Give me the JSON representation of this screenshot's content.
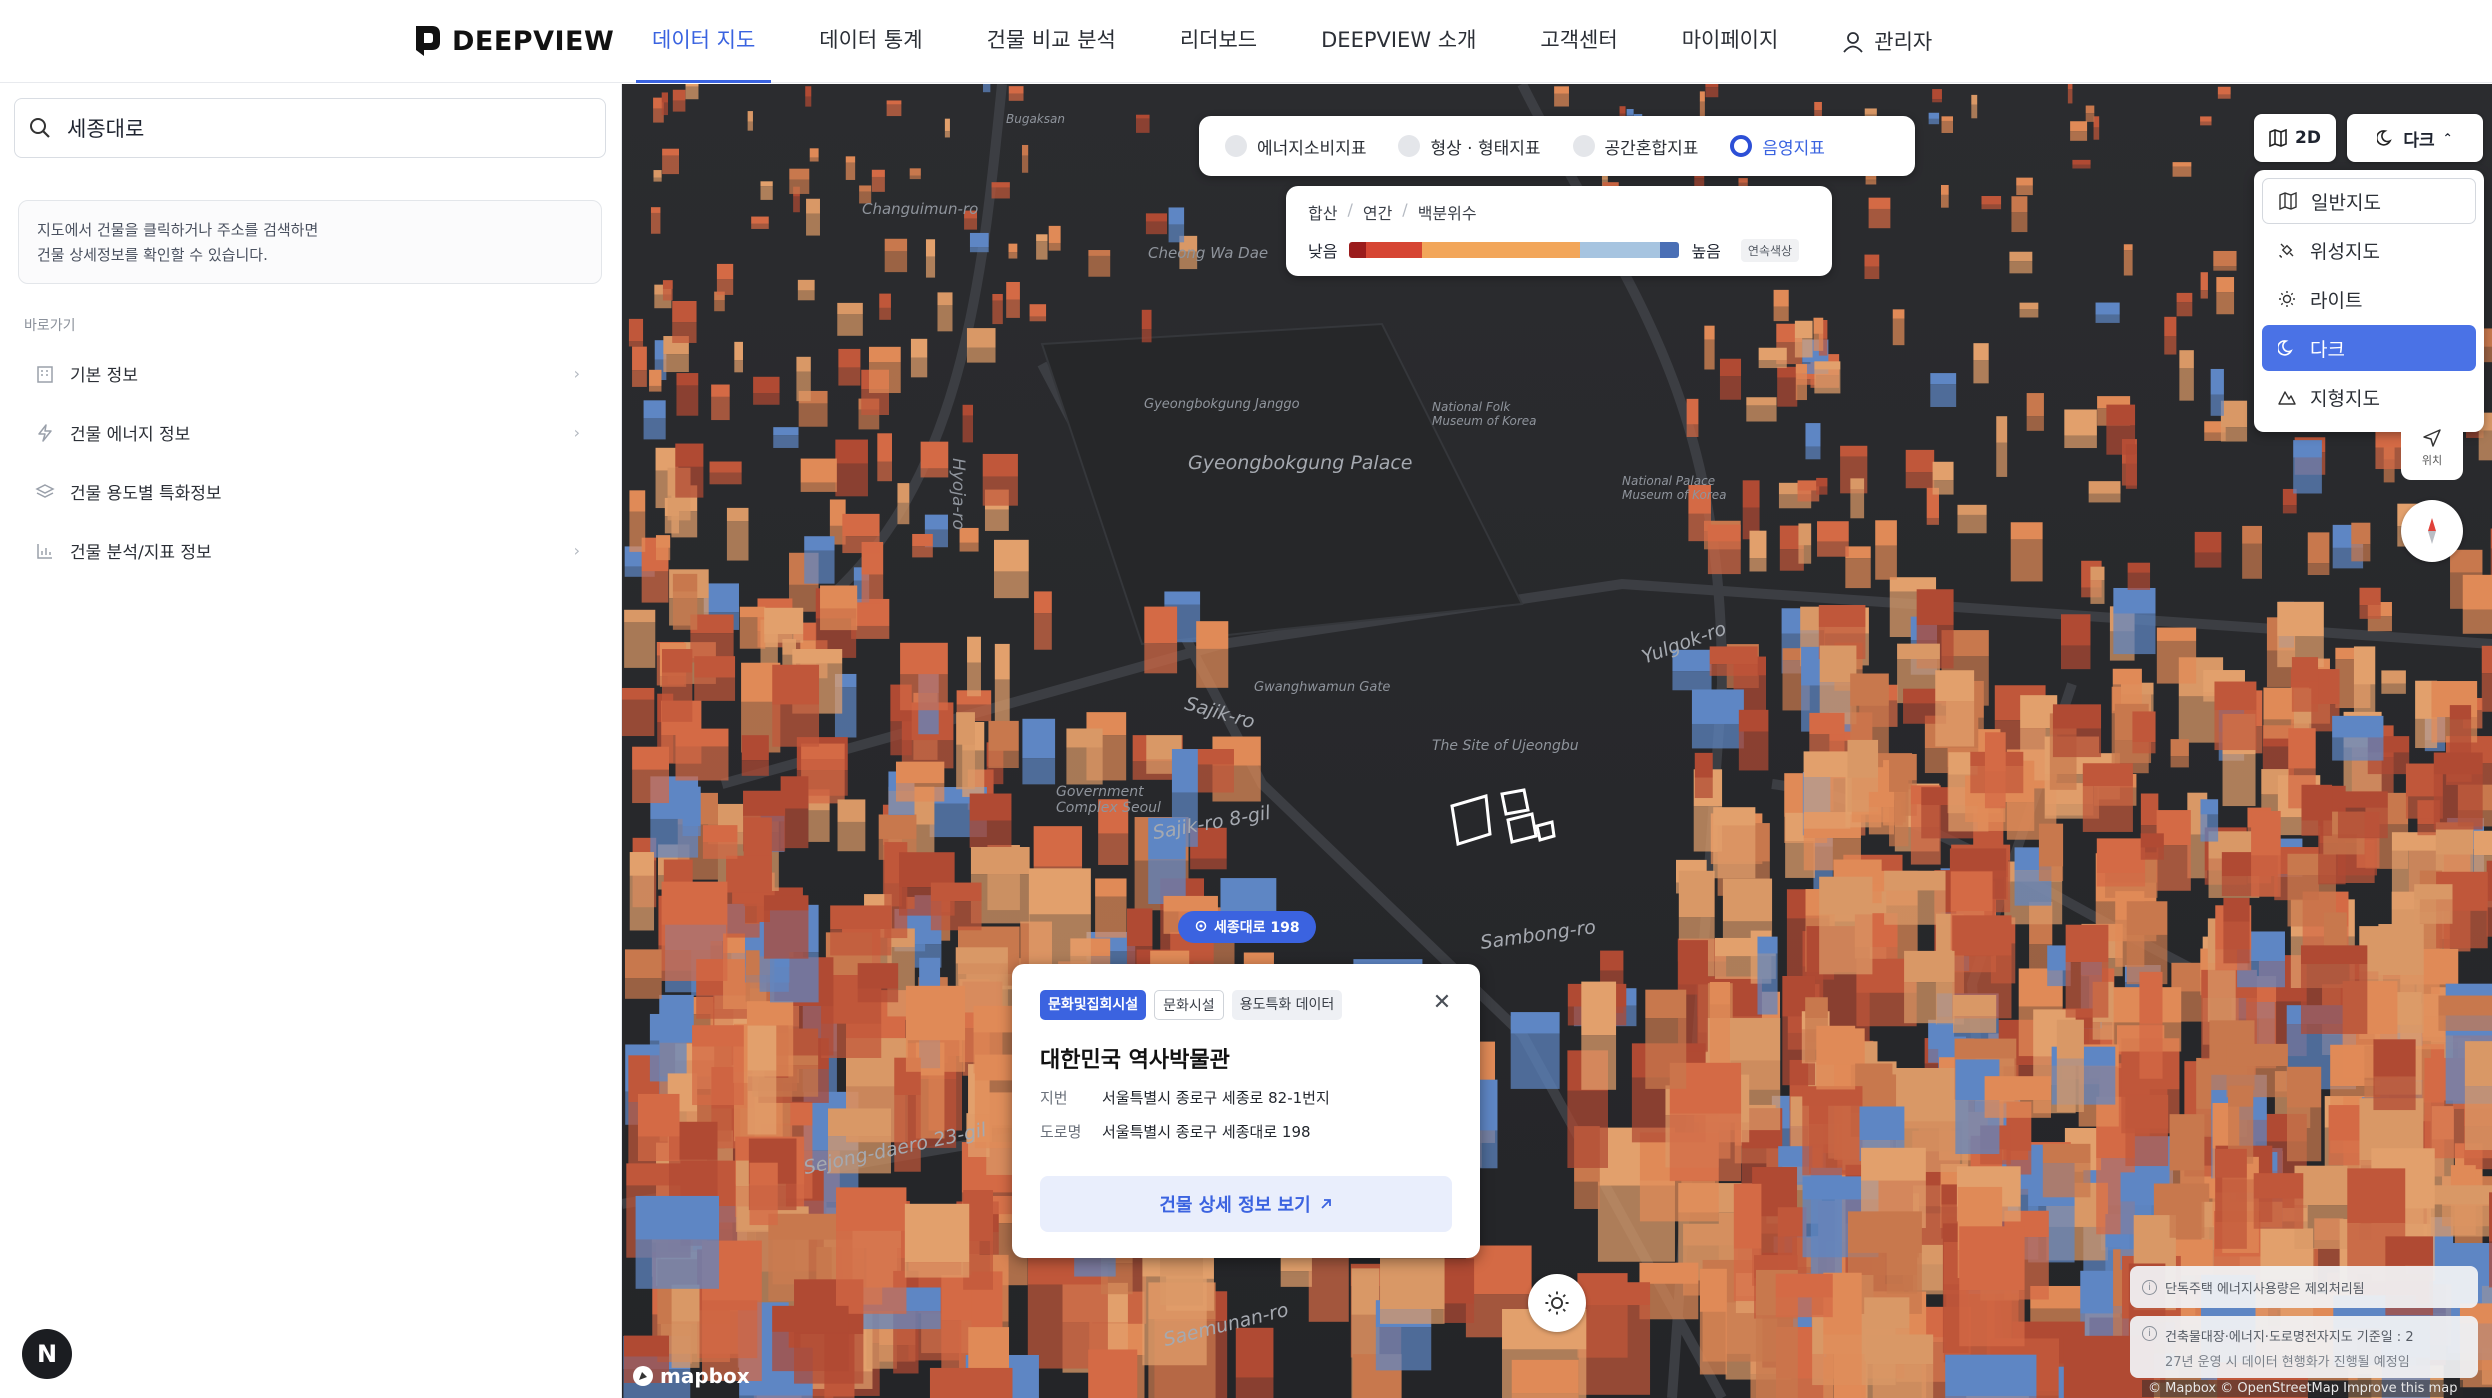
{
  "header": {
    "logo_text": "DEEPVIEW",
    "nav": [
      {
        "label": "데이터 지도",
        "active": true
      },
      {
        "label": "데이터 통계"
      },
      {
        "label": "건물 비교 분석"
      },
      {
        "label": "리더보드"
      },
      {
        "label": "DEEPVIEW 소개"
      },
      {
        "label": "고객센터"
      },
      {
        "label": "마이페이지"
      }
    ],
    "user_label": "관리자"
  },
  "sidebar": {
    "search_value": "세종대로",
    "hint_line1": "지도에서 건물을 클릭하거나 주소를 검색하면",
    "hint_line2": "건물 상세정보를 확인할 수 있습니다.",
    "section_label": "바로가기",
    "items": [
      {
        "label": "기본 정보",
        "icon": "building-icon"
      },
      {
        "label": "건물 에너지 정보",
        "icon": "lightning-icon"
      },
      {
        "label": "건물 용도별 특화정보",
        "icon": "layers-icon"
      },
      {
        "label": "건물 분석/지표 정보",
        "icon": "bar-chart-icon"
      }
    ],
    "badge": "N"
  },
  "map": {
    "index_tabs": [
      {
        "label": "에너지소비지표"
      },
      {
        "label": "형상 · 형태지표"
      },
      {
        "label": "공간혼합지표"
      },
      {
        "label": "음영지표",
        "active": true
      }
    ],
    "legend": {
      "crumbs": [
        "합산",
        "연간",
        "백분위수"
      ],
      "low": "낮음",
      "high": "높음",
      "chip": "연속색상",
      "colors": [
        "#9b1c1c",
        "#d64533",
        "#f2a65a",
        "#a6c4e0",
        "#4a6fb5"
      ]
    },
    "view_toggle": "2D",
    "style_button": "다크",
    "styles": [
      {
        "label": "일반지도",
        "icon": "map-icon"
      },
      {
        "label": "위성지도",
        "icon": "satellite-icon"
      },
      {
        "label": "라이트",
        "icon": "sun-icon"
      },
      {
        "label": "다크",
        "icon": "moon-icon",
        "selected": true
      },
      {
        "label": "지형지도",
        "icon": "mountain-icon"
      }
    ],
    "locate_label": "위치",
    "address_pin": "세종대로 198",
    "labels": {
      "palace": "Gyeongbokgung Palace",
      "palace_gate": "Gyeongbokgung Janggo",
      "cheong": "Cheong Wa Dae",
      "sajik": "Sajik-ro",
      "sajik8": "Sajik-ro 8-gil",
      "sambong": "Sambong-ro",
      "yulgok": "Yulgok-ro",
      "hyoja": "Hyoja-ro",
      "saemunan": "Saemunan-ro",
      "sejong23": "Sejong-daero 23-gil",
      "gwanghwamun": "Gwanghwamun Gate",
      "museum": "National Folk Museum of Korea",
      "govt": "Government Complex Seoul",
      "national_museum": "National Palace Museum of Korea",
      "ujeongbu": "The Site of Ujeongbu",
      "bukchon": "Bugaksan",
      "changuimun": "Changuimun-ro"
    },
    "popup": {
      "tags": [
        "문화및집회시설",
        "문화시설",
        "용도특화 데이터"
      ],
      "title": "대한민국 역사박물관",
      "jibun_key": "지번",
      "jibun_value": "서울특별시 종로구 세종로 82-1번지",
      "road_key": "도로명",
      "road_value": "서울특별시 종로구 세종대로 198",
      "button": "건물 상세 정보 보기"
    },
    "mapbox_logo": "mapbox",
    "notice1": "단독주택 에너지사용량은 제외처리됨",
    "notice2_line1": "건축물대장·에너지·도로명전자지도 기준일 : 2",
    "notice2_line2": "27년 운영 시 데이터 현행화가 진행될 예정임",
    "attribution": "© Mapbox © OpenStreetMap Improve this map"
  }
}
